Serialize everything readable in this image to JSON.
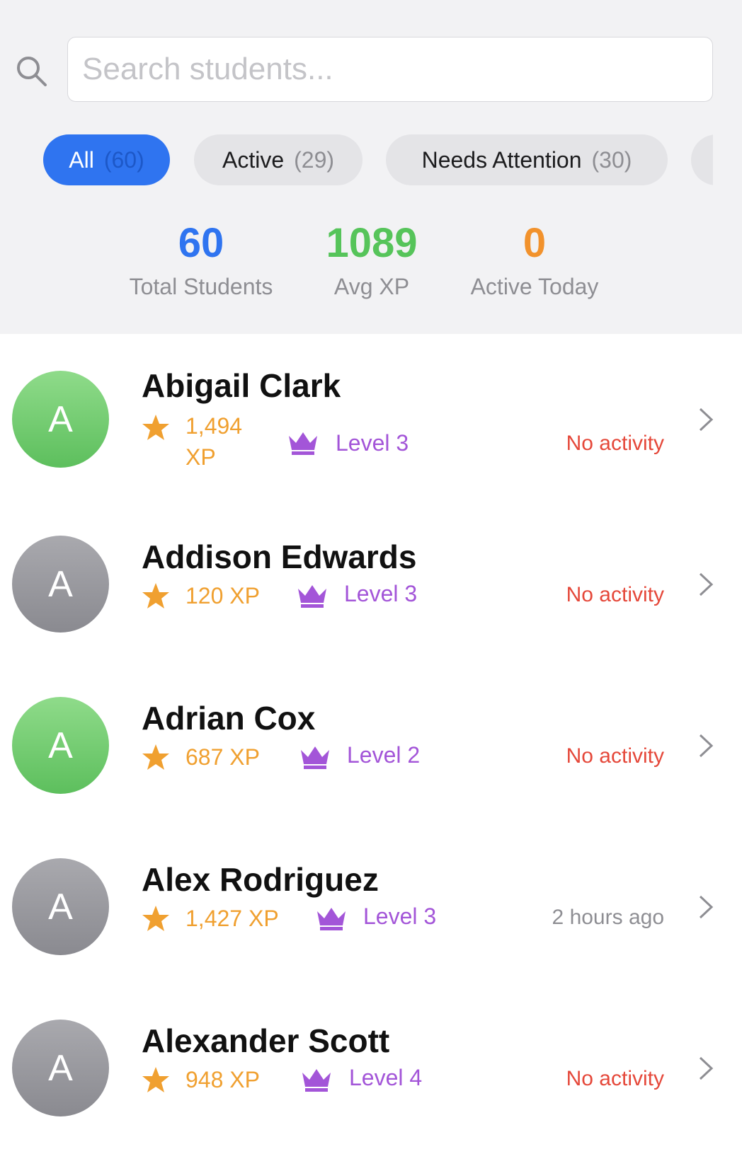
{
  "search": {
    "placeholder": "Search students..."
  },
  "filters": [
    {
      "label": "All",
      "count": "(60)",
      "selected": true
    },
    {
      "label": "Active",
      "count": "(29)",
      "selected": false
    },
    {
      "label": "Needs Attention",
      "count": "(30)",
      "selected": false
    }
  ],
  "stats": [
    {
      "value": "60",
      "label": "Total Students",
      "color": "#2f74f0"
    },
    {
      "value": "1089",
      "label": "Avg XP",
      "color": "#56c45a"
    },
    {
      "value": "0",
      "label": "Active Today",
      "color": "#f2922c"
    }
  ],
  "students": [
    {
      "initial": "A",
      "name": "Abigail Clark",
      "xp": "1,494 XP",
      "level": "Level 3",
      "activity": "No activity",
      "avatar_color": "green"
    },
    {
      "initial": "A",
      "name": "Addison Edwards",
      "xp": "120 XP",
      "level": "Level 3",
      "activity": "No activity",
      "avatar_color": "gray"
    },
    {
      "initial": "A",
      "name": "Adrian Cox",
      "xp": "687 XP",
      "level": "Level 2",
      "activity": "No activity",
      "avatar_color": "green"
    },
    {
      "initial": "A",
      "name": "Alex Rodriguez",
      "xp": "1,427 XP",
      "level": "Level 3",
      "activity": "2 hours ago",
      "avatar_color": "gray"
    },
    {
      "initial": "A",
      "name": "Alexander Scott",
      "xp": "948 XP",
      "level": "Level 4",
      "activity": "No activity",
      "avatar_color": "gray"
    }
  ],
  "icons": {
    "search": "search-icon",
    "xp": "star-icon",
    "level": "crown-icon",
    "disclosure": "chevron-right-icon"
  },
  "colors": {
    "accent": "#2f74f0",
    "xp": "#f0a030",
    "level": "#a355d8",
    "no_activity": "#e5483a"
  }
}
